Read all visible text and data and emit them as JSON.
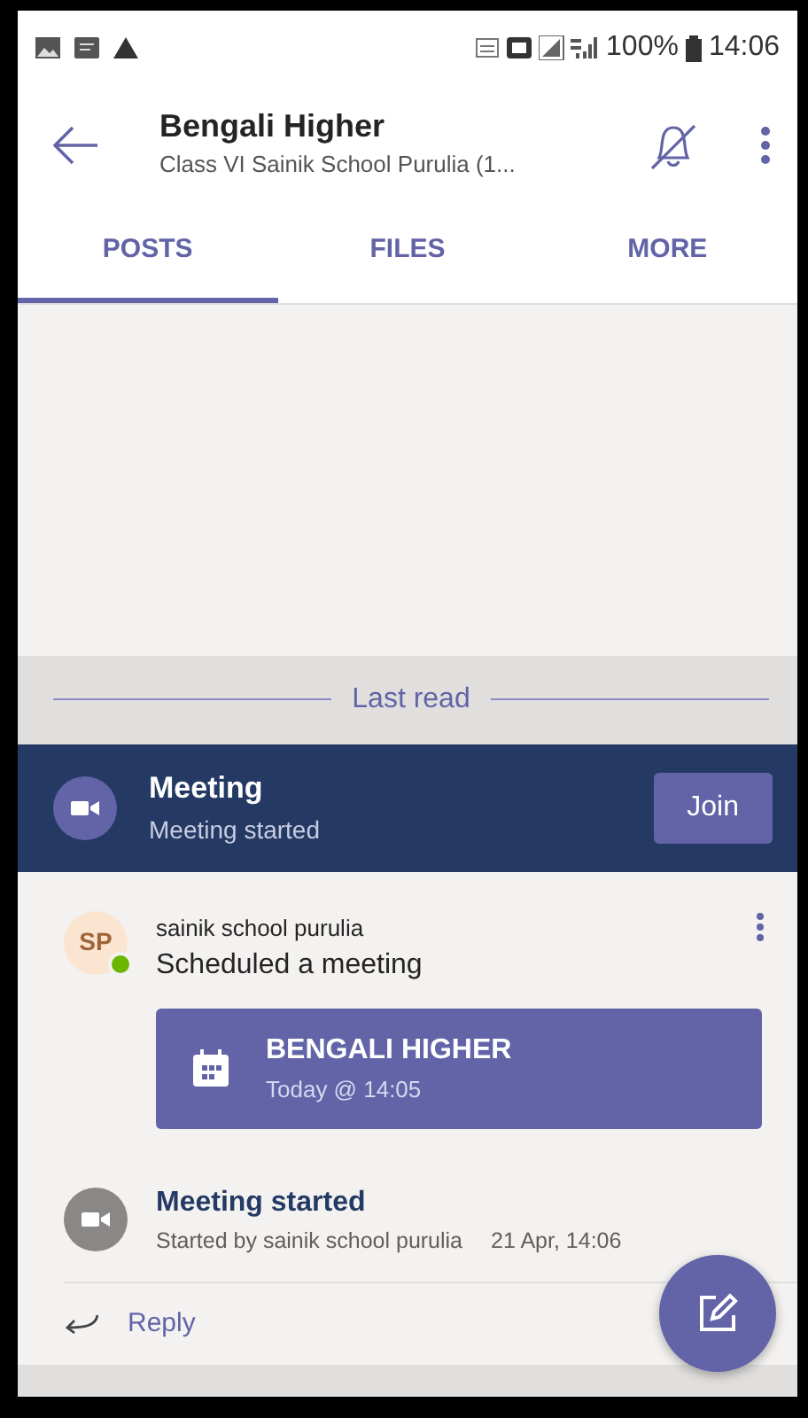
{
  "status_bar": {
    "battery": "100%",
    "time": "14:06"
  },
  "header": {
    "title": "Bengali Higher",
    "subtitle": "Class VI Sainik School Purulia (1..."
  },
  "tabs": [
    {
      "label": "POSTS",
      "selected": true
    },
    {
      "label": "FILES",
      "selected": false
    },
    {
      "label": "MORE",
      "selected": false
    }
  ],
  "divider": {
    "label": "Last read"
  },
  "meeting_banner": {
    "title": "Meeting",
    "subtitle": "Meeting started",
    "button": "Join"
  },
  "post": {
    "avatar": "SP",
    "online": true,
    "author": "sainik school purulia",
    "text": "Scheduled a meeting",
    "event": {
      "title": "BENGALI HIGHER",
      "time": "Today @ 14:05"
    }
  },
  "activity": {
    "title": "Meeting started",
    "detail": "Started by sainik school purulia",
    "date": "21 Apr, 14:06"
  },
  "reply": {
    "label": "Reply"
  }
}
